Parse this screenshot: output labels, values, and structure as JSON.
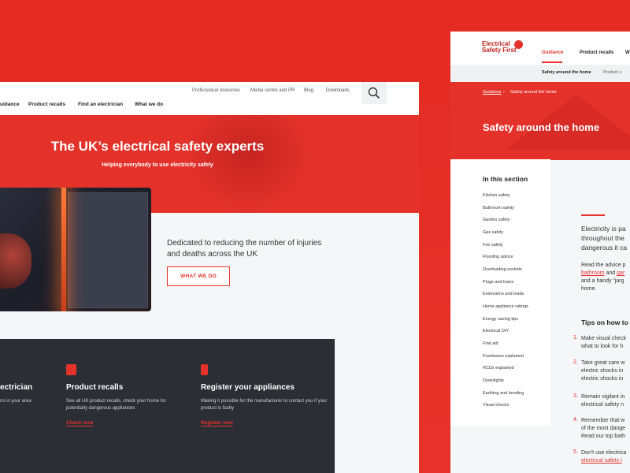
{
  "colors": {
    "brand_red": "#e4322b",
    "dark_panel": "#2c2e35",
    "light_bg": "#f5f6f8"
  },
  "left": {
    "utility_nav": [
      "Professional resources",
      "Media centre and PR",
      "Blog",
      "Downloads"
    ],
    "main_nav": [
      "uidance",
      "Product recalls",
      "Find an electrician",
      "What we do"
    ],
    "search_icon": "search-icon",
    "hero_title": "The UK’s electrical safety experts",
    "hero_subtitle": "Helping everybody to use electricity safely",
    "intro": "Dedicated to reducing the number of injuries and deaths across the UK",
    "cta": "WHAT WE DO",
    "cards": [
      {
        "title": "ectrician",
        "body": "ns in your area",
        "link": ""
      },
      {
        "title": "Product recalls",
        "body": "See all UK product recalls, check your home for potentially dangerous appliances",
        "link": "Check now"
      },
      {
        "title": "Register your appliances",
        "body": "Making it possible for the manufacturer to contact you if your product is faulty",
        "link": "Register now"
      }
    ]
  },
  "right": {
    "logo_line1": "Electrical",
    "logo_line2": "Safety First",
    "nav": [
      "Guidance",
      "Product recalls",
      "W"
    ],
    "subnav": [
      "Safety around the home",
      "Product s"
    ],
    "breadcrumb_root": "Guidance",
    "breadcrumb_current": "Safety around the home",
    "page_title": "Safety around the home",
    "section_title": "In this section",
    "section_items": [
      "Kitchen safety",
      "Bathroom safety",
      "Garden safety",
      "Gas safety",
      "Fire safety",
      "Flooding advice",
      "Overloading sockets",
      "Plugs and fuses",
      "Extensions and leads",
      "Home appliance ratings",
      "Energy saving tips",
      "Electrical DIY",
      "First aid",
      "Fuseboxes explained",
      "RCDs explained",
      "Downlights",
      "Earthing and bonding",
      "Visual checks"
    ],
    "lead_lines": [
      "Electricity is pa",
      "throughout the",
      "dangerous it ca"
    ],
    "para": {
      "line1": "Read the advice p",
      "link1": "bathroom",
      "and": " and ",
      "link2": "gar",
      "line3": "and a handy “jarg",
      "line4": "home."
    },
    "tips_title": "Tips on how to",
    "tips": [
      {
        "num": "1.",
        "lines": [
          "Make visual check",
          "what to look for h"
        ]
      },
      {
        "num": "2.",
        "lines": [
          "Take great care w",
          "electric shocks in",
          "electric shocks in"
        ]
      },
      {
        "num": "3.",
        "lines": [
          "Remain vigilant in",
          "electrical safety n"
        ]
      },
      {
        "num": "4.",
        "lines": [
          "Remember that w",
          "of the most dange",
          "Read our top bath"
        ]
      },
      {
        "num": "5.",
        "lines": [
          "Don't use electrica",
          "electrical safety i"
        ]
      }
    ]
  }
}
